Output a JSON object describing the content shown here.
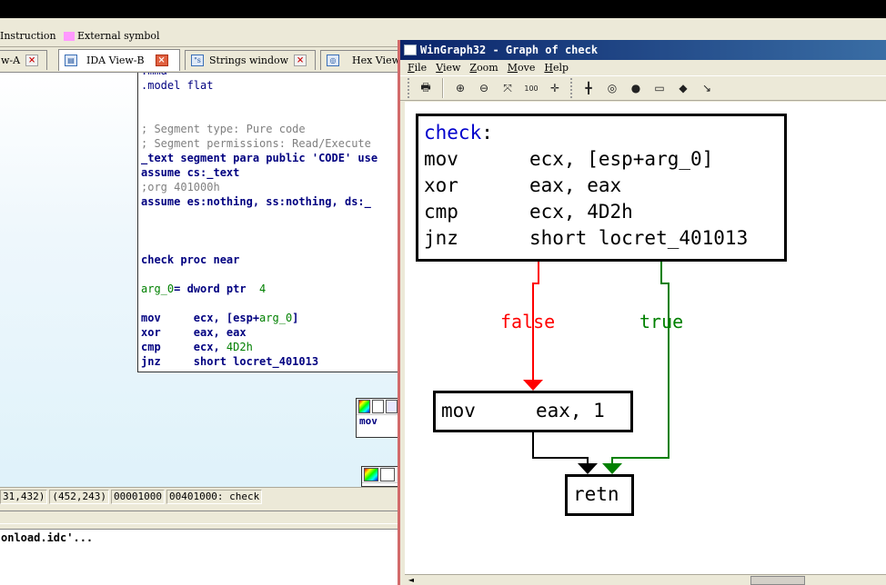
{
  "legend": {
    "items": [
      {
        "label": "Instruction",
        "color": ""
      },
      {
        "label": "External symbol",
        "color": "#ff99ff"
      }
    ]
  },
  "tabs": [
    {
      "label": "w-A",
      "active": false,
      "close_red": false
    },
    {
      "label": "IDA View-B",
      "active": true,
      "close_red": true
    },
    {
      "label": "Strings window",
      "active": false,
      "close_red": false
    },
    {
      "label": "Hex View",
      "active": false,
      "close_red": false
    }
  ],
  "code": {
    "lines": [
      {
        "parts": [
          {
            "t": ".mma",
            "c": "c-blk"
          }
        ]
      },
      {
        "parts": [
          {
            "t": ".model flat",
            "c": "c-blk"
          }
        ]
      },
      {
        "parts": []
      },
      {
        "parts": []
      },
      {
        "parts": [
          {
            "t": "; Segment type: Pure code",
            "c": "c-gray"
          }
        ]
      },
      {
        "parts": [
          {
            "t": "; Segment permissions: Read/Execute",
            "c": "c-gray"
          }
        ]
      },
      {
        "parts": [
          {
            "t": "_text segment para public 'CODE' use",
            "c": "c-navy"
          }
        ]
      },
      {
        "parts": [
          {
            "t": "assume cs:_text",
            "c": "c-navy"
          }
        ]
      },
      {
        "parts": [
          {
            "t": ";org 401000h",
            "c": "c-gray"
          }
        ]
      },
      {
        "parts": [
          {
            "t": "assume es:nothing, ss:nothing, ds:_",
            "c": "c-navy"
          }
        ]
      },
      {
        "parts": []
      },
      {
        "parts": []
      },
      {
        "parts": []
      },
      {
        "parts": [
          {
            "t": "check proc near",
            "c": "c-navy"
          }
        ]
      },
      {
        "parts": []
      },
      {
        "parts": [
          {
            "t": "arg_0",
            "c": "c-green"
          },
          {
            "t": "= dword ptr  ",
            "c": "c-navy"
          },
          {
            "t": "4",
            "c": "c-green"
          }
        ]
      },
      {
        "parts": []
      },
      {
        "parts": [
          {
            "t": "mov     ecx, [esp+",
            "c": "c-navy"
          },
          {
            "t": "arg_0",
            "c": "c-green"
          },
          {
            "t": "]",
            "c": "c-navy"
          }
        ]
      },
      {
        "parts": [
          {
            "t": "xor     eax, eax",
            "c": "c-navy"
          }
        ]
      },
      {
        "parts": [
          {
            "t": "cmp     ecx, ",
            "c": "c-navy"
          },
          {
            "t": "4D2h",
            "c": "c-green"
          }
        ]
      },
      {
        "parts": [
          {
            "t": "jnz     short locret_401013",
            "c": "c-navy"
          }
        ]
      }
    ]
  },
  "mini_nodes": [
    {
      "text": "mov"
    },
    {
      "text": ""
    }
  ],
  "status": {
    "cells": [
      "31,432)",
      "(452,243)",
      "00001000",
      "00401000: check"
    ]
  },
  "output": {
    "line": "onload.idc'..."
  },
  "graph_window": {
    "title": "WinGraph32 - Graph of check",
    "menu": [
      {
        "key": "F",
        "rest": "ile"
      },
      {
        "key": "V",
        "rest": "iew"
      },
      {
        "key": "Z",
        "rest": "oom"
      },
      {
        "key": "M",
        "rest": "ove"
      },
      {
        "key": "H",
        "rest": "elp"
      }
    ],
    "toolbar": [
      {
        "name": "print-icon",
        "glyph": "🖶"
      },
      {
        "name": "zoom-in-icon",
        "glyph": "⊕"
      },
      {
        "name": "zoom-out-icon",
        "glyph": "⊖"
      },
      {
        "name": "fit-icon",
        "glyph": "⤧"
      },
      {
        "name": "zoom-100-icon",
        "glyph": "100"
      },
      {
        "name": "center-icon",
        "glyph": "✛"
      },
      {
        "name": "grid-icon",
        "glyph": "╋"
      },
      {
        "name": "nav-1-icon",
        "glyph": "◎"
      },
      {
        "name": "nav-2-icon",
        "glyph": "●"
      },
      {
        "name": "nav-3-icon",
        "glyph": "▭"
      },
      {
        "name": "nav-4-icon",
        "glyph": "◆"
      },
      {
        "name": "cursor-icon",
        "glyph": "↘"
      }
    ],
    "nodes": {
      "check": {
        "label": "check",
        "colon": ":",
        "rows": [
          {
            "op": "mov",
            "args": "ecx, [esp+arg_0]"
          },
          {
            "op": "xor",
            "args": "eax, eax"
          },
          {
            "op": "cmp",
            "args": "ecx, 4D2h"
          },
          {
            "op": "jnz",
            "args": "short locret_401013"
          }
        ]
      },
      "mov": {
        "op": "mov",
        "args": "eax, 1"
      },
      "retn": {
        "op": "retn"
      }
    },
    "edges": {
      "false_label": "false",
      "true_label": "true",
      "false_color": "#ff0000",
      "true_color": "#008000"
    }
  }
}
